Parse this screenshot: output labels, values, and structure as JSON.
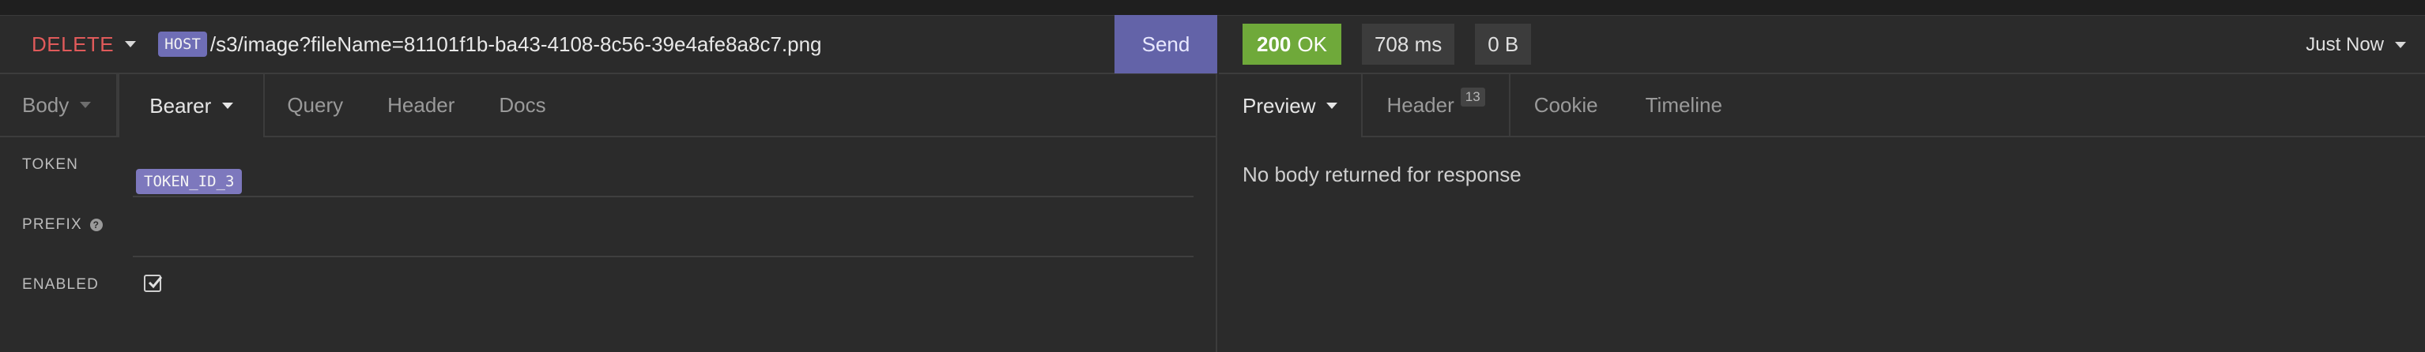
{
  "request": {
    "method": "DELETE",
    "host_tag": "HOST",
    "url_path": "/s3/image?fileName=81101f1b-ba43-4108-8c56-39e4afe8a8c7.png",
    "send_label": "Send",
    "tabs": {
      "body": "Body",
      "bearer": "Bearer",
      "query": "Query",
      "header": "Header",
      "docs": "Docs"
    },
    "auth": {
      "token_label": "TOKEN",
      "token_value": "TOKEN_ID_3",
      "prefix_label": "PREFIX",
      "enabled_label": "ENABLED",
      "enabled": true
    }
  },
  "response": {
    "status_code": "200",
    "status_text": "OK",
    "time": "708 ms",
    "size": "0 B",
    "timeline_label": "Just Now",
    "tabs": {
      "preview": "Preview",
      "header": "Header",
      "header_count": "13",
      "cookie": "Cookie",
      "timeline": "Timeline"
    },
    "body_message": "No body returned for response"
  },
  "colors": {
    "background": "#2b2b2b",
    "method_delete": "#e05a5a",
    "send_button": "#6363a8",
    "tag_purple": "#7d78bd",
    "status_ok": "#6fa93a"
  }
}
